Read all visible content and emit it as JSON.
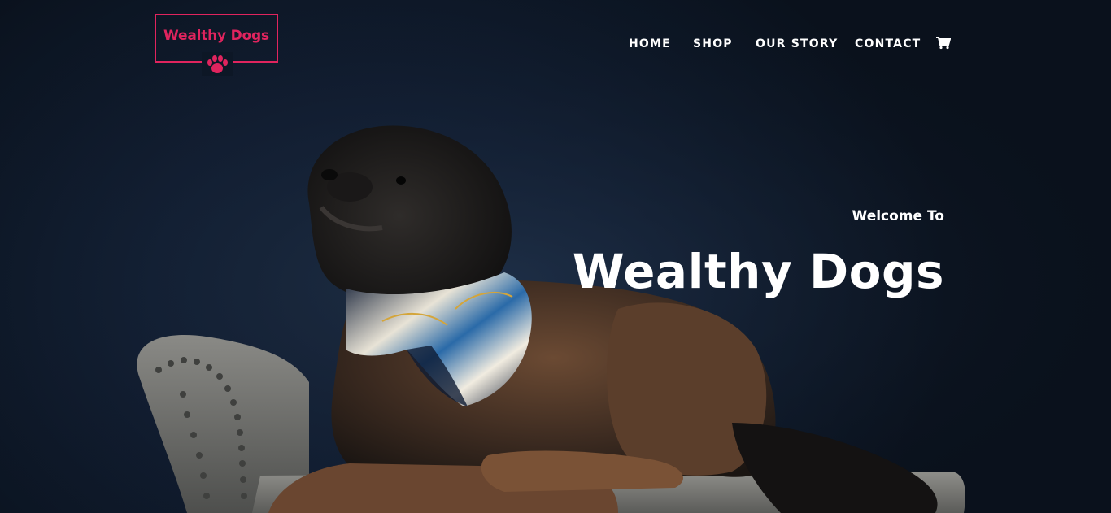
{
  "logo": {
    "text": "Wealthy Dogs",
    "icon": "paw-icon",
    "color": "#e0245e"
  },
  "nav": {
    "items": [
      {
        "label": "HOME"
      },
      {
        "label": "SHOP"
      },
      {
        "label": "OUR STORY"
      },
      {
        "label": "CONTACT"
      }
    ],
    "cart_icon": "shopping-cart-icon"
  },
  "hero": {
    "welcome": "Welcome To",
    "title": "Wealthy Dogs",
    "image": "photo of a curly-haired dog wearing a silk scarf lying on a grey velvet chaise"
  }
}
